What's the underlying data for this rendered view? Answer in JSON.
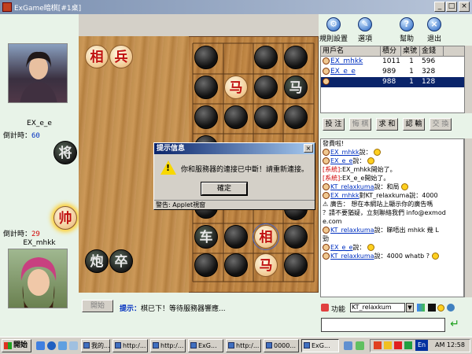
{
  "window": {
    "title": "ExGame暗棋[#1桌]",
    "min": "_",
    "max": "□",
    "close": "×"
  },
  "players": {
    "top": {
      "name": "EX_e_e",
      "timer_label": "倒計時：",
      "timer_value": "60",
      "piece": "将"
    },
    "bottom": {
      "name": "EX_mhkk",
      "timer_label": "倒計時：",
      "timer_value": "29",
      "piece": "帅"
    }
  },
  "board": {
    "captured_left": [
      {
        "char": "相",
        "side": "red"
      },
      {
        "char": "兵",
        "side": "red"
      },
      {
        "char": "车",
        "side": "black"
      },
      {
        "char": "炮",
        "side": "black"
      },
      {
        "char": "卒",
        "side": "black"
      }
    ],
    "grid_pieces": [
      {
        "char": "马",
        "side": "red"
      },
      {
        "char": "马",
        "side": "black"
      },
      {
        "char": "相",
        "side": "red"
      },
      {
        "char": "马",
        "side": "red"
      }
    ]
  },
  "game_bottom": {
    "start_label": "開始",
    "hint_label": "提示：",
    "hint_text": "棋已下！等待服務器響應..."
  },
  "toolbar": {
    "items": [
      {
        "label": "規則設置",
        "icon": "rules-icon"
      },
      {
        "label": "選項",
        "icon": "options-icon"
      },
      {
        "label": "幫助",
        "icon": "help-icon"
      },
      {
        "label": "退出",
        "icon": "exit-icon"
      }
    ]
  },
  "usertable": {
    "headers": [
      "用戶名",
      "積分",
      "桌號",
      "金錢"
    ],
    "rows": [
      {
        "name": "EX_mhkk",
        "score": "1011",
        "table": "1",
        "money": "596"
      },
      {
        "name": "EX_e_e",
        "score": "989",
        "table": "1",
        "money": "328"
      },
      {
        "name": "",
        "score": "988",
        "table": "1",
        "money": "128"
      }
    ]
  },
  "actions": {
    "buttons": [
      "投 注",
      "悔 棋",
      "求 和",
      "認 輸",
      "交 換"
    ]
  },
  "chat": {
    "lines": [
      {
        "prefix": "",
        "user": "",
        "text": "發費啦!"
      },
      {
        "prefix": "",
        "user": "EX_mhkk",
        "text": "說："
      },
      {
        "prefix": "",
        "user": "EX_e_e",
        "text": "說："
      },
      {
        "prefix": "[系統]",
        "user": "",
        "text": ":EX_mhkk開始了。"
      },
      {
        "prefix": "[系統]",
        "user": "",
        "text": ":EX_e_e開始了。"
      },
      {
        "prefix": "",
        "user": "KT_relaxkuma",
        "text": "說：和局"
      },
      {
        "prefix": "",
        "user": "EX_mhkk",
        "text": "對KT_relaxkuma說：4000"
      },
      {
        "prefix": "",
        "user": "",
        "text": "廣告： 想在本網站上顯示你的廣告嗎"
      },
      {
        "prefix": "",
        "user": "",
        "text": "？請不要猶疑，立刻聯絡我們 info@exmod"
      },
      {
        "prefix": "",
        "user": "",
        "text": "e.com"
      },
      {
        "prefix": "",
        "user": "KT_relaxkuma",
        "text": "說：睇唔出 mhkk 幾 L"
      },
      {
        "prefix": "",
        "user": "",
        "text": "勁"
      },
      {
        "prefix": "",
        "user": "EX_e_e",
        "text": "說："
      },
      {
        "prefix": "",
        "user": "KT_relaxkuma",
        "text": "說：4000 whatb ?"
      }
    ],
    "func_label": "功能",
    "func_value": "KT_relaxkum"
  },
  "dialog": {
    "title": "提示信息",
    "message": "你和服務器的連接已中斷！請重新連接。",
    "ok": "確定",
    "footer": "警告: Applet視窗"
  },
  "taskbar": {
    "start": "開始",
    "tasks": [
      "我的...",
      "http:/...",
      "http:/...",
      "ExG...",
      "http:/...",
      "0000...",
      "ExG..."
    ],
    "clock": "AM 12:58",
    "ime": "En"
  }
}
